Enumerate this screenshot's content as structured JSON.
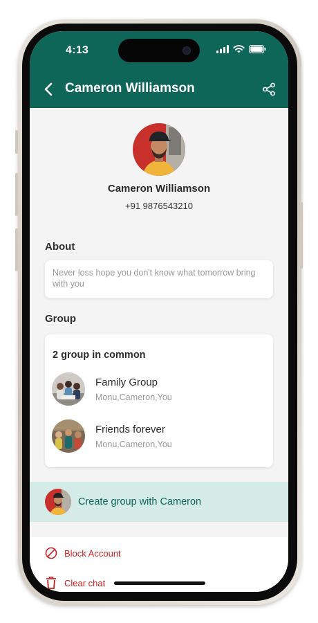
{
  "status_bar": {
    "time": "4:13"
  },
  "nav": {
    "title": "Cameron Williamson"
  },
  "profile": {
    "name": "Cameron Williamson",
    "phone": "+91 9876543210"
  },
  "about": {
    "label": "About",
    "text": "Never loss hope you don't know what tomorrow bring with you"
  },
  "group": {
    "label": "Group",
    "count_text": "2 group in common",
    "items": [
      {
        "name": "Family Group",
        "members": "Monu,Cameron,You"
      },
      {
        "name": "Friends forever",
        "members": "Monu,Cameron,You"
      }
    ]
  },
  "create_group": {
    "label": "Create group with Cameron"
  },
  "actions": {
    "block": "Block Account",
    "clear": "Clear chat"
  },
  "colors": {
    "header": "#0e6659",
    "accent_bg": "#d5ebe7",
    "danger": "#d01f1f",
    "background": "#f4f4f4"
  },
  "icons": [
    "back-arrow-icon",
    "share-icon",
    "block-icon",
    "trash-icon",
    "signal-icon",
    "wifi-icon",
    "battery-icon"
  ]
}
